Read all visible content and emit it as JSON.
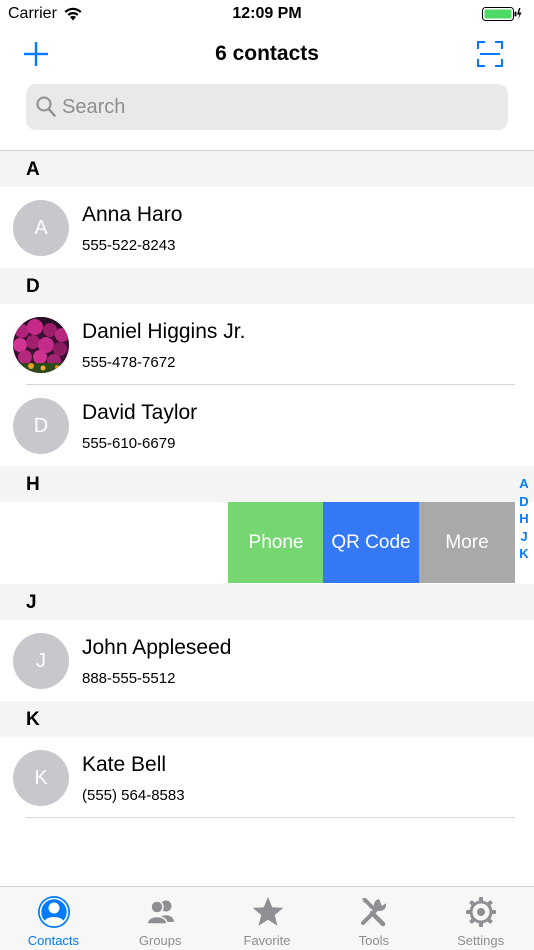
{
  "status_bar": {
    "carrier": "Carrier",
    "time": "12:09 PM"
  },
  "nav": {
    "title": "6 contacts",
    "add_icon": "plus-icon",
    "scan_icon": "scan-frame-icon"
  },
  "search": {
    "placeholder": "Search",
    "value": ""
  },
  "sections": {
    "a": {
      "letter": "A"
    },
    "d": {
      "letter": "D"
    },
    "h": {
      "letter": "H"
    },
    "j": {
      "letter": "J"
    },
    "k": {
      "letter": "K"
    }
  },
  "contacts": {
    "anna": {
      "initial": "A",
      "name": "Anna Haro",
      "phone": "555-522-8243"
    },
    "daniel": {
      "initial": "",
      "name": "Daniel Higgins Jr.",
      "phone": "555-478-7672"
    },
    "david": {
      "initial": "D",
      "name": "David Taylor",
      "phone": "555-610-6679"
    },
    "john": {
      "initial": "J",
      "name": "John Appleseed",
      "phone": "888-555-5512"
    },
    "kate": {
      "initial": "K",
      "name": "Kate Bell",
      "phone": "(555) 564-8583"
    }
  },
  "swipe_actions": {
    "phone": "Phone",
    "qr_code": "QR Code",
    "more": "More"
  },
  "index": [
    "A",
    "D",
    "H",
    "J",
    "K"
  ],
  "tabs": {
    "contacts": "Contacts",
    "groups": "Groups",
    "favorite": "Favorite",
    "tools": "Tools",
    "settings": "Settings"
  },
  "colors": {
    "accent": "#007aff",
    "phone_action": "#76d672",
    "qr_action": "#3478f6",
    "more_action": "#a9a9a9"
  }
}
